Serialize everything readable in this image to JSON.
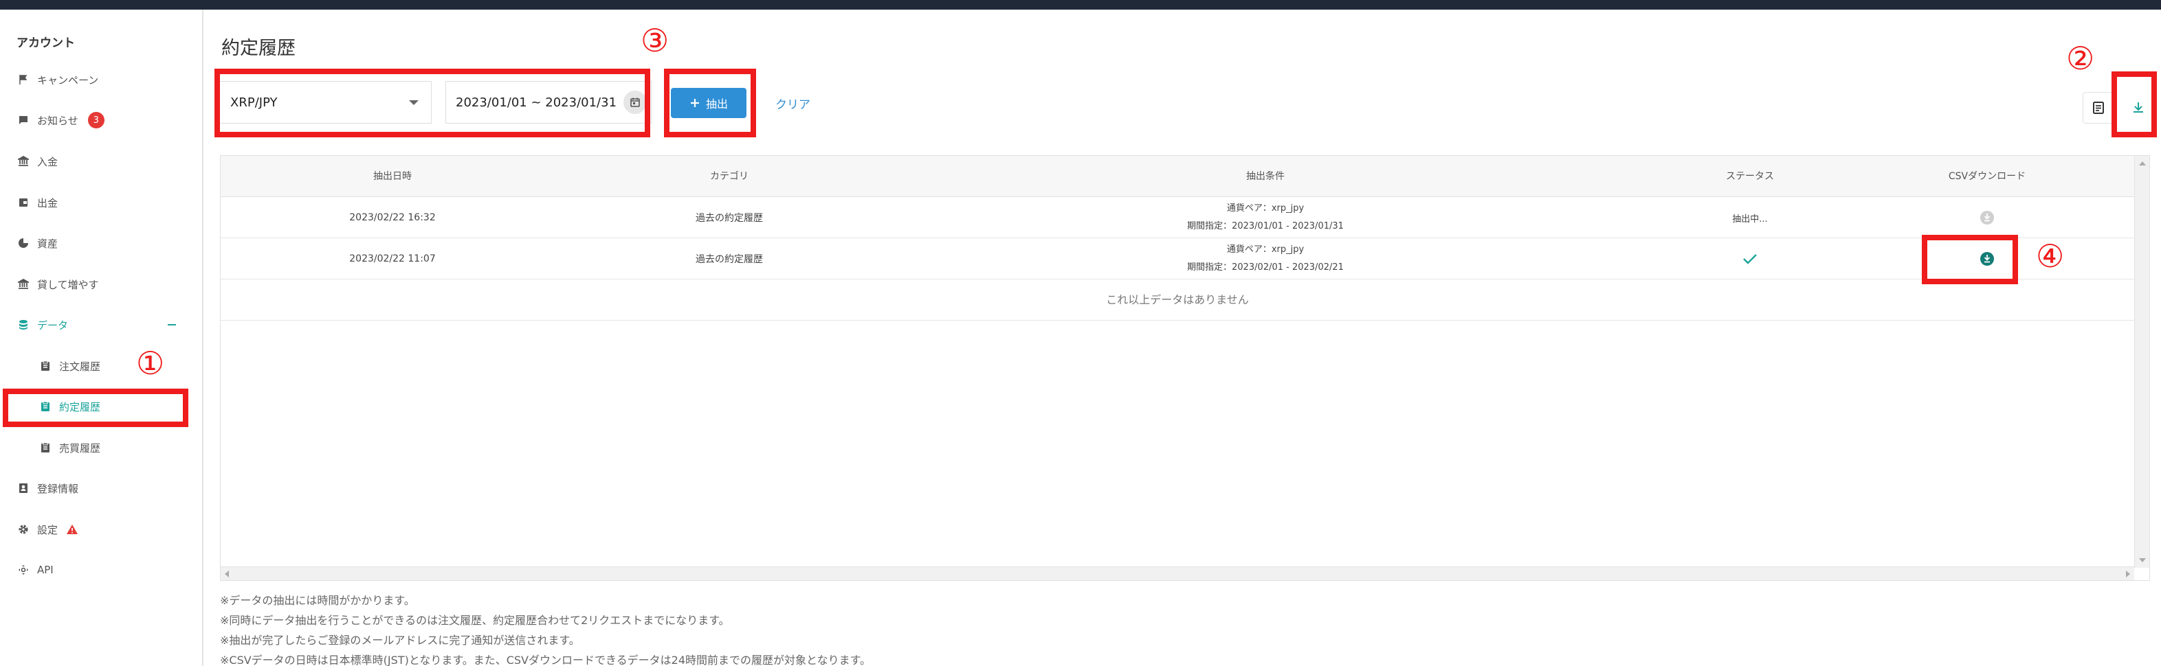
{
  "sidebar": {
    "title": "アカウント",
    "items": [
      {
        "label": "キャンペーン",
        "icon": "flag-icon"
      },
      {
        "label": "お知らせ",
        "icon": "message-icon",
        "badge": "3"
      },
      {
        "label": "入金",
        "icon": "bank-icon"
      },
      {
        "label": "出金",
        "icon": "wallet-icon"
      },
      {
        "label": "資産",
        "icon": "pie-chart-icon"
      },
      {
        "label": "貸して増やす",
        "icon": "bank-icon"
      },
      {
        "label": "データ",
        "icon": "database-icon"
      },
      {
        "label": "注文履歴",
        "icon": "clipboard-icon"
      },
      {
        "label": "約定履歴",
        "icon": "clipboard-icon"
      },
      {
        "label": "売買履歴",
        "icon": "clipboard-icon"
      },
      {
        "label": "登録情報",
        "icon": "id-card-icon"
      },
      {
        "label": "設定",
        "icon": "gear-icon"
      },
      {
        "label": "API",
        "icon": "api-icon"
      }
    ]
  },
  "main": {
    "title": "約定履歴",
    "pair_value": "XRP/JPY",
    "date_range": "2023/01/01 ~ 2023/01/31",
    "extract_label": "抽出",
    "clear_label": "クリア"
  },
  "table": {
    "headers": [
      "抽出日時",
      "カテゴリ",
      "抽出条件",
      "ステータス",
      "CSVダウンロード"
    ],
    "rows": [
      {
        "datetime": "2023/02/22 16:32",
        "category": "過去の約定履歴",
        "cond1": "通貨ペア：xrp_jpy",
        "cond2": "期間指定：2023/01/01 - 2023/01/31",
        "status": "抽出中..."
      },
      {
        "datetime": "2023/02/22 11:07",
        "category": "過去の約定履歴",
        "cond1": "通貨ペア：xrp_jpy",
        "cond2": "期間指定：2023/02/01 - 2023/02/21",
        "status": ""
      }
    ],
    "no_more": "これ以上データはありません"
  },
  "notes": [
    "※データの抽出には時間がかかります。",
    "※同時にデータ抽出を行うことができるのは注文履歴、約定履歴合わせて2リクエストまでになります。",
    "※抽出が完了したらご登録のメールアドレスに完了通知が送信されます。",
    "※CSVデータの日時は日本標準時(JST)となります。また、CSVダウンロードできるデータは24時間前までの履歴が対象となります。"
  ],
  "annotations": [
    "①",
    "②",
    "③",
    "④"
  ],
  "colors": {
    "accent": "#1aa39a",
    "primary": "#2f8fd6",
    "highlight": "#ee1c1c",
    "badge": "#e53935"
  }
}
